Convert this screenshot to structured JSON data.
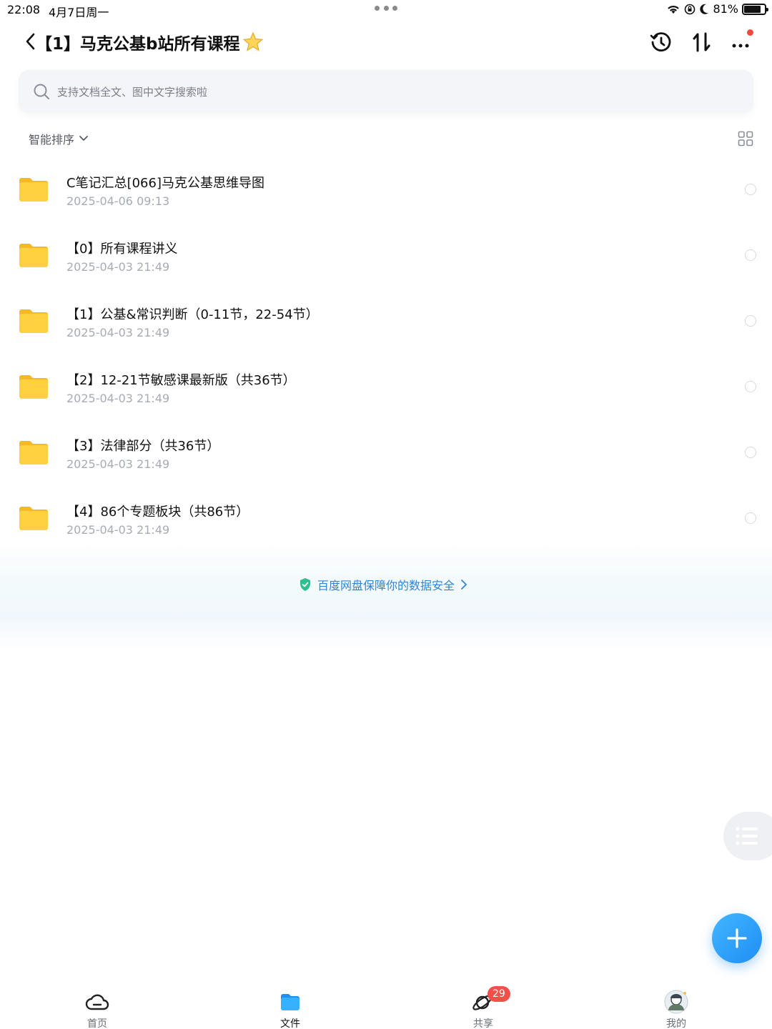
{
  "status_bar": {
    "time": "22:08",
    "date": "4月7日周一",
    "battery": "81%",
    "battery_level": 0.81
  },
  "header": {
    "title": "【1】马克公基b站所有课程",
    "title_emoji": "star-icon"
  },
  "search": {
    "placeholder": "支持文档全文、图中文字搜索啦"
  },
  "sort": {
    "label": "智能排序"
  },
  "files": [
    {
      "name": "C笔记汇总[066]马克公基思维导图",
      "time": "2025-04-06 09:13"
    },
    {
      "name": "【0】所有课程讲义",
      "time": "2025-04-03 21:49"
    },
    {
      "name": "【1】公基&常识判断（0-11节，22-54节）",
      "time": "2025-04-03 21:49"
    },
    {
      "name": "【2】12-21节敏感课最新版（共36节）",
      "time": "2025-04-03 21:49"
    },
    {
      "name": "【3】法律部分（共36节）",
      "time": "2025-04-03 21:49"
    },
    {
      "name": "【4】86个专题板块（共86节）",
      "time": "2025-04-03 21:49"
    }
  ],
  "safety_banner": "百度网盘保障你的数据安全",
  "tabs": [
    {
      "label": "首页"
    },
    {
      "label": "文件"
    },
    {
      "label": "共享",
      "badge": "29"
    },
    {
      "label": "我的"
    }
  ],
  "colors": {
    "accent": "#1f8ef5",
    "folder": "#ffce3d",
    "badge": "#f2504a"
  }
}
